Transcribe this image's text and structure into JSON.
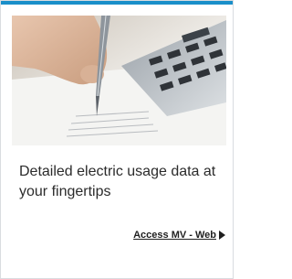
{
  "card": {
    "image": {
      "description_icon": "calculator-pen-paper-icon"
    },
    "headline": "Detailed electric usage data at your fingertips",
    "link": {
      "label": "Access MV - Web",
      "icon": "arrow-right-icon"
    }
  },
  "colors": {
    "accent": "#1a8fc9",
    "text": "#2b2b2b",
    "link": "#1f1f1f",
    "border": "#d9dce0"
  }
}
